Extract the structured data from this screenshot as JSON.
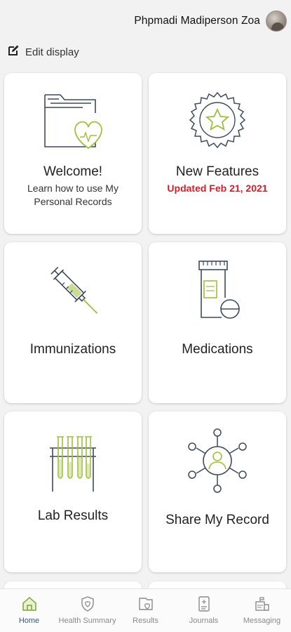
{
  "header": {
    "user_name": "Phpmadi Madiperson Zoa"
  },
  "edit_display": {
    "label": "Edit display",
    "icon": "edit-icon"
  },
  "tiles": [
    {
      "title": "Welcome!",
      "subtitle": "Learn how to use My Personal Records",
      "icon": "folder-heart-icon"
    },
    {
      "title": "New Features",
      "subtitle": "Updated Feb 21, 2021",
      "subtitle_color": "#d41f2a",
      "icon": "star-badge-icon"
    },
    {
      "title": "Immunizations",
      "icon": "syringe-icon"
    },
    {
      "title": "Medications",
      "icon": "pill-bottle-icon"
    },
    {
      "title": "Lab Results",
      "icon": "test-tubes-icon"
    },
    {
      "title": "Share My Record",
      "icon": "share-network-icon"
    }
  ],
  "bottom_nav": [
    {
      "label": "Home",
      "icon": "home-icon",
      "active": true
    },
    {
      "label": "Health Summary",
      "icon": "shield-heart-icon",
      "active": false
    },
    {
      "label": "Results",
      "icon": "results-icon",
      "active": false
    },
    {
      "label": "Journals",
      "icon": "journal-icon",
      "active": false
    },
    {
      "label": "Messaging",
      "icon": "messaging-icon",
      "active": false
    }
  ],
  "colors": {
    "accent_red": "#d41f2a",
    "icon_green": "#9fc03c",
    "icon_navy": "#3d4a5c",
    "nav_active": "#2d5b86",
    "background": "#f2f2f2"
  }
}
